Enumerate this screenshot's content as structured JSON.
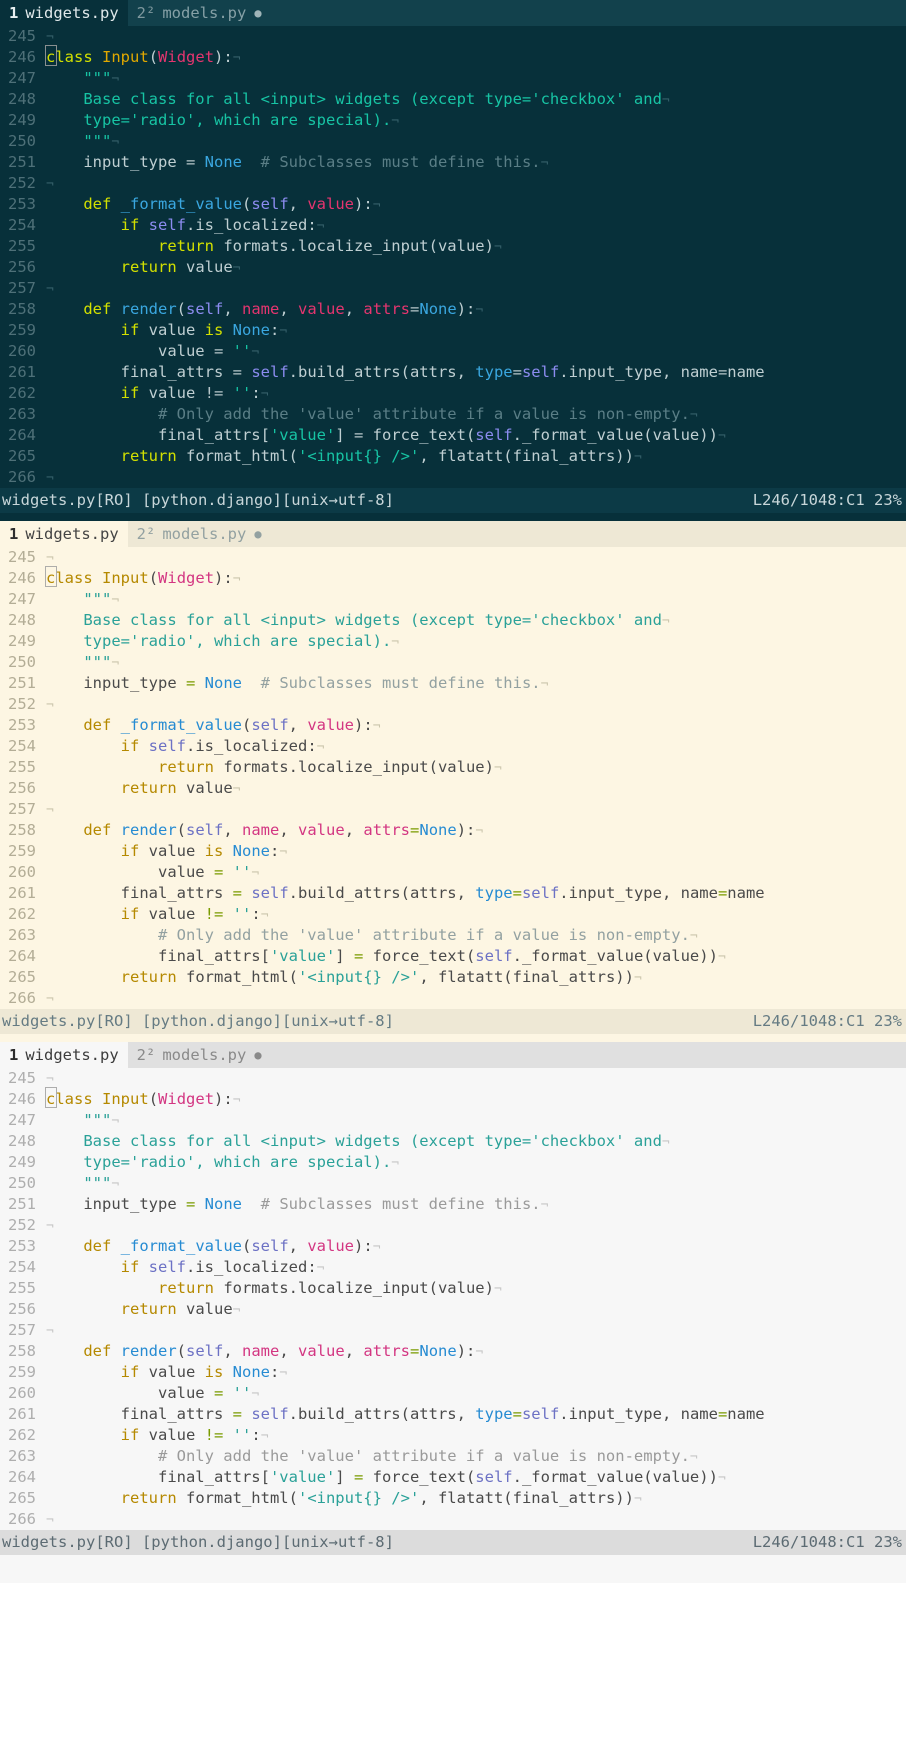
{
  "editor": {
    "app": "text-editor",
    "tabs": [
      {
        "number": "1",
        "label": "widgets.py",
        "active": true,
        "modified": false,
        "modified_glyph": ""
      },
      {
        "number": "2²",
        "label": "models.py",
        "active": false,
        "modified": true,
        "modified_glyph": "●"
      }
    ],
    "status": {
      "left": "widgets.py[RO] [python.django][unix→utf-8]",
      "filename": "widgets.py",
      "readonly_badge": "[RO]",
      "filetype": "[python.django]",
      "encoding": "[unix→utf-8]",
      "right": "L246/1048:C1 23%",
      "line": "246",
      "total_lines": "1048",
      "column": "C1",
      "percent": "23%"
    },
    "eol_glyph": "¬",
    "cursor_line": "246",
    "cursor_col": 1,
    "lines": [
      {
        "n": "245",
        "tokens": []
      },
      {
        "n": "246",
        "tokens": [
          {
            "t": "class",
            "c": "kw",
            "cursor": true
          },
          {
            "t": " ",
            "c": "pln"
          },
          {
            "t": "Input",
            "c": "fn"
          },
          {
            "t": "(",
            "c": "pln"
          },
          {
            "t": "Widget",
            "c": "cls"
          },
          {
            "t": "):",
            "c": "pln"
          }
        ]
      },
      {
        "n": "247",
        "tokens": [
          {
            "t": "    ",
            "c": "pln"
          },
          {
            "t": "\"\"\"",
            "c": "str"
          }
        ]
      },
      {
        "n": "248",
        "tokens": [
          {
            "t": "    Base class for all <input> widgets (except type='checkbox' and",
            "c": "str"
          }
        ]
      },
      {
        "n": "249",
        "tokens": [
          {
            "t": "    type='radio', which are special).",
            "c": "str"
          }
        ]
      },
      {
        "n": "250",
        "tokens": [
          {
            "t": "    ",
            "c": "pln"
          },
          {
            "t": "\"\"\"",
            "c": "str"
          }
        ]
      },
      {
        "n": "251",
        "tokens": [
          {
            "t": "    input_type ",
            "c": "pln"
          },
          {
            "t": "=",
            "c": "op"
          },
          {
            "t": " ",
            "c": "pln"
          },
          {
            "t": "None",
            "c": "num"
          },
          {
            "t": "  ",
            "c": "pln"
          },
          {
            "t": "# Subclasses must define this.",
            "c": "com"
          }
        ]
      },
      {
        "n": "252",
        "tokens": []
      },
      {
        "n": "253",
        "tokens": [
          {
            "t": "    ",
            "c": "pln"
          },
          {
            "t": "def",
            "c": "kw"
          },
          {
            "t": " ",
            "c": "pln"
          },
          {
            "t": "_format_value",
            "c": "kw2"
          },
          {
            "t": "(",
            "c": "pln"
          },
          {
            "t": "self",
            "c": "selfc"
          },
          {
            "t": ", ",
            "c": "pln"
          },
          {
            "t": "value",
            "c": "cls"
          },
          {
            "t": "):",
            "c": "pln"
          }
        ]
      },
      {
        "n": "254",
        "tokens": [
          {
            "t": "        ",
            "c": "pln"
          },
          {
            "t": "if",
            "c": "kw"
          },
          {
            "t": " ",
            "c": "pln"
          },
          {
            "t": "self",
            "c": "selfc"
          },
          {
            "t": ".is_localized:",
            "c": "pln"
          }
        ]
      },
      {
        "n": "255",
        "tokens": [
          {
            "t": "            ",
            "c": "pln"
          },
          {
            "t": "return",
            "c": "kw"
          },
          {
            "t": " formats.localize_input(value)",
            "c": "pln"
          }
        ]
      },
      {
        "n": "256",
        "tokens": [
          {
            "t": "        ",
            "c": "pln"
          },
          {
            "t": "return",
            "c": "kw"
          },
          {
            "t": " value",
            "c": "pln"
          }
        ]
      },
      {
        "n": "257",
        "tokens": []
      },
      {
        "n": "258",
        "tokens": [
          {
            "t": "    ",
            "c": "pln"
          },
          {
            "t": "def",
            "c": "kw"
          },
          {
            "t": " ",
            "c": "pln"
          },
          {
            "t": "render",
            "c": "kw2"
          },
          {
            "t": "(",
            "c": "pln"
          },
          {
            "t": "self",
            "c": "selfc"
          },
          {
            "t": ", ",
            "c": "pln"
          },
          {
            "t": "name",
            "c": "cls"
          },
          {
            "t": ", ",
            "c": "pln"
          },
          {
            "t": "value",
            "c": "cls"
          },
          {
            "t": ", ",
            "c": "pln"
          },
          {
            "t": "attrs",
            "c": "cls"
          },
          {
            "t": "=",
            "c": "op"
          },
          {
            "t": "None",
            "c": "num"
          },
          {
            "t": "):",
            "c": "pln"
          }
        ]
      },
      {
        "n": "259",
        "tokens": [
          {
            "t": "        ",
            "c": "pln"
          },
          {
            "t": "if",
            "c": "kw"
          },
          {
            "t": " value ",
            "c": "pln"
          },
          {
            "t": "is",
            "c": "kw"
          },
          {
            "t": " ",
            "c": "pln"
          },
          {
            "t": "None",
            "c": "num"
          },
          {
            "t": ":",
            "c": "pln"
          }
        ]
      },
      {
        "n": "260",
        "tokens": [
          {
            "t": "            value ",
            "c": "pln"
          },
          {
            "t": "=",
            "c": "op"
          },
          {
            "t": " ",
            "c": "pln"
          },
          {
            "t": "''",
            "c": "str"
          }
        ]
      },
      {
        "n": "261",
        "tokens": [
          {
            "t": "        final_attrs ",
            "c": "pln"
          },
          {
            "t": "=",
            "c": "op"
          },
          {
            "t": " ",
            "c": "pln"
          },
          {
            "t": "self",
            "c": "selfc"
          },
          {
            "t": ".build_attrs(attrs, ",
            "c": "pln"
          },
          {
            "t": "type",
            "c": "kw2"
          },
          {
            "t": "=",
            "c": "op"
          },
          {
            "t": "self",
            "c": "selfc"
          },
          {
            "t": ".input_type, name",
            "c": "pln"
          },
          {
            "t": "=",
            "c": "op"
          },
          {
            "t": "name",
            "c": "pln"
          }
        ],
        "truncated": true
      },
      {
        "n": "262",
        "tokens": [
          {
            "t": "        ",
            "c": "pln"
          },
          {
            "t": "if",
            "c": "kw"
          },
          {
            "t": " value ",
            "c": "pln"
          },
          {
            "t": "!=",
            "c": "op"
          },
          {
            "t": " ",
            "c": "pln"
          },
          {
            "t": "''",
            "c": "str"
          },
          {
            "t": ":",
            "c": "pln"
          }
        ]
      },
      {
        "n": "263",
        "tokens": [
          {
            "t": "            ",
            "c": "pln"
          },
          {
            "t": "# Only add the 'value' attribute if a value is non-empty.",
            "c": "com"
          }
        ]
      },
      {
        "n": "264",
        "tokens": [
          {
            "t": "            final_attrs[",
            "c": "pln"
          },
          {
            "t": "'value'",
            "c": "str"
          },
          {
            "t": "] ",
            "c": "pln"
          },
          {
            "t": "=",
            "c": "op"
          },
          {
            "t": " force_text(",
            "c": "pln"
          },
          {
            "t": "self",
            "c": "selfc"
          },
          {
            "t": "._format_value(value))",
            "c": "pln"
          }
        ]
      },
      {
        "n": "265",
        "tokens": [
          {
            "t": "        ",
            "c": "pln"
          },
          {
            "t": "return",
            "c": "kw"
          },
          {
            "t": " format_html(",
            "c": "pln"
          },
          {
            "t": "'<input{} />'",
            "c": "str"
          },
          {
            "t": ", flatatt(final_attrs))",
            "c": "pln"
          }
        ]
      },
      {
        "n": "266",
        "tokens": []
      }
    ]
  },
  "panels": [
    {
      "theme": "t-dark",
      "name": "editor-panel-dark",
      "colors": {
        "bg": "#07303a",
        "status_bg": "#0c3a46",
        "tab_inactive_bg": "#12414c"
      }
    },
    {
      "theme": "t-cream",
      "name": "editor-panel-solarized",
      "colors": {
        "bg": "#fdf6e3",
        "status_bg": "#eee8d5",
        "tab_inactive_bg": "#eee8d5"
      }
    },
    {
      "theme": "t-grey",
      "name": "editor-panel-light",
      "colors": {
        "bg": "#f7f7f7",
        "status_bg": "#dcdcdc",
        "tab_inactive_bg": "#e0e0e0"
      }
    }
  ]
}
